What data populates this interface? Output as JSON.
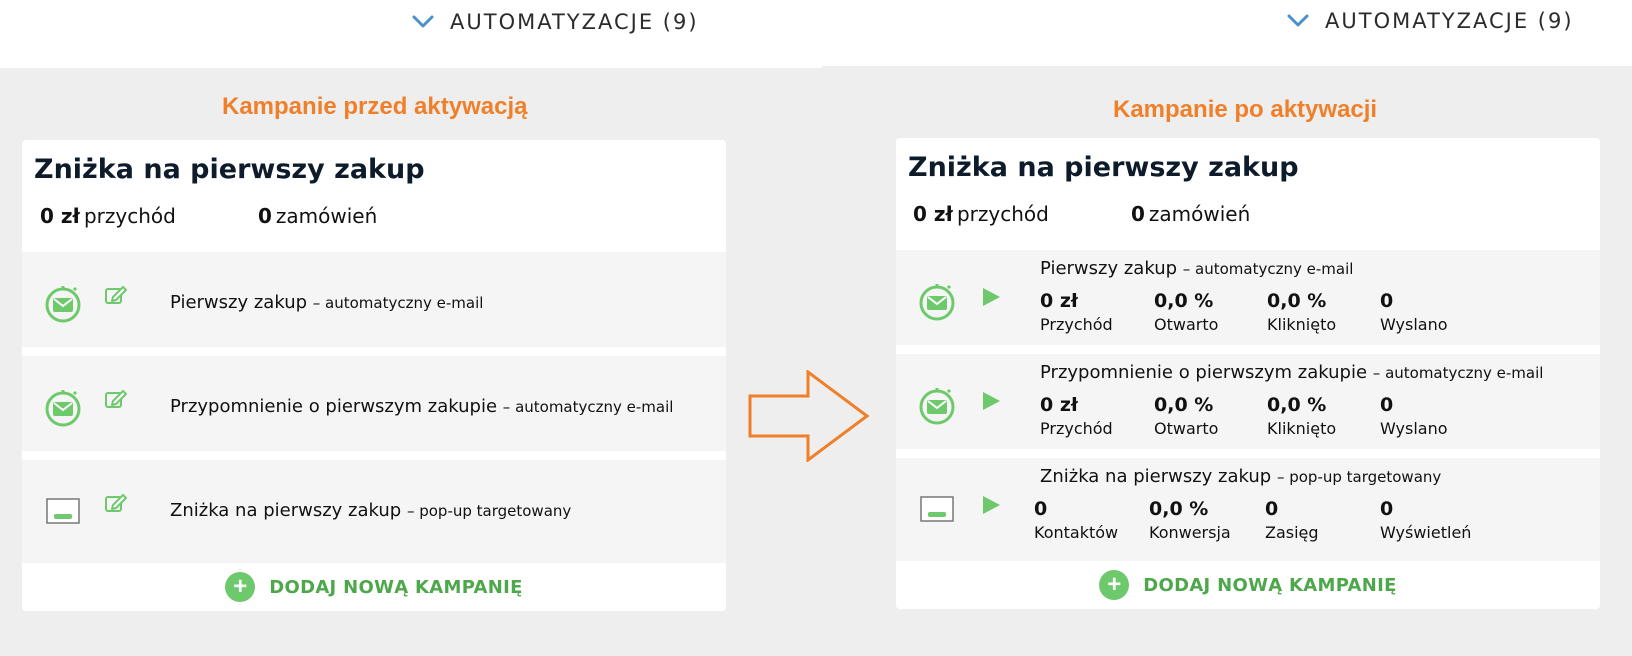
{
  "automations_label": "AUTOMATYZACJE (9)",
  "left": {
    "section_title": "Kampanie przed aktywacją",
    "card": {
      "title": "Zniżka na pierwszy zakup",
      "revenue_value": "0 zł",
      "revenue_label": "przychód",
      "orders_value": "0",
      "orders_label": "zamówień",
      "campaigns": [
        {
          "name": "Pierwszy zakup",
          "type": "– automatyczny e-mail",
          "icon": "email-clock-icon",
          "action_icon": "edit-icon"
        },
        {
          "name": "Przypomnienie o pierwszym zakupie",
          "type": "– automatyczny e-mail",
          "icon": "email-clock-icon",
          "action_icon": "edit-icon"
        },
        {
          "name": "Zniżka na pierwszy zakup",
          "type": "– pop-up targetowany",
          "icon": "popup-icon",
          "action_icon": "edit-icon"
        }
      ],
      "add_label": "DODAJ NOWĄ KAMPANIĘ"
    }
  },
  "right": {
    "section_title": "Kampanie po aktywacji",
    "card": {
      "title": "Zniżka na pierwszy zakup",
      "revenue_value": "0 zł",
      "revenue_label": "przychód",
      "orders_value": "0",
      "orders_label": "zamówień",
      "campaigns": [
        {
          "name": "Pierwszy zakup",
          "type": "– automatyczny e-mail",
          "icon": "email-clock-icon",
          "action_icon": "play-icon",
          "stats": [
            {
              "value": "0 zł",
              "label": "Przychód"
            },
            {
              "value": "0,0 %",
              "label": "Otwarto"
            },
            {
              "value": "0,0 %",
              "label": "Kliknięto"
            },
            {
              "value": "0",
              "label": "Wyslano"
            }
          ]
        },
        {
          "name": "Przypomnienie o pierwszym zakupie",
          "type": "– automatyczny e-mail",
          "icon": "email-clock-icon",
          "action_icon": "play-icon",
          "stats": [
            {
              "value": "0 zł",
              "label": "Przychód"
            },
            {
              "value": "0,0 %",
              "label": "Otwarto"
            },
            {
              "value": "0,0 %",
              "label": "Kliknięto"
            },
            {
              "value": "0",
              "label": "Wyslano"
            }
          ]
        },
        {
          "name": "Zniżka na pierwszy zakup",
          "type": "– pop-up targetowany",
          "icon": "popup-icon",
          "action_icon": "play-icon",
          "stats": [
            {
              "value": "0",
              "label": "Kontaktów"
            },
            {
              "value": "0,0 %",
              "label": "Konwersja"
            },
            {
              "value": "0",
              "label": "Zasięg"
            },
            {
              "value": "0",
              "label": "Wyświetleń"
            }
          ]
        }
      ],
      "add_label": "DODAJ NOWĄ KAMPANIĘ"
    }
  },
  "colors": {
    "accent_orange": "#f07f2a",
    "accent_green": "#6dc96b",
    "chevron_blue": "#4a90c9"
  }
}
